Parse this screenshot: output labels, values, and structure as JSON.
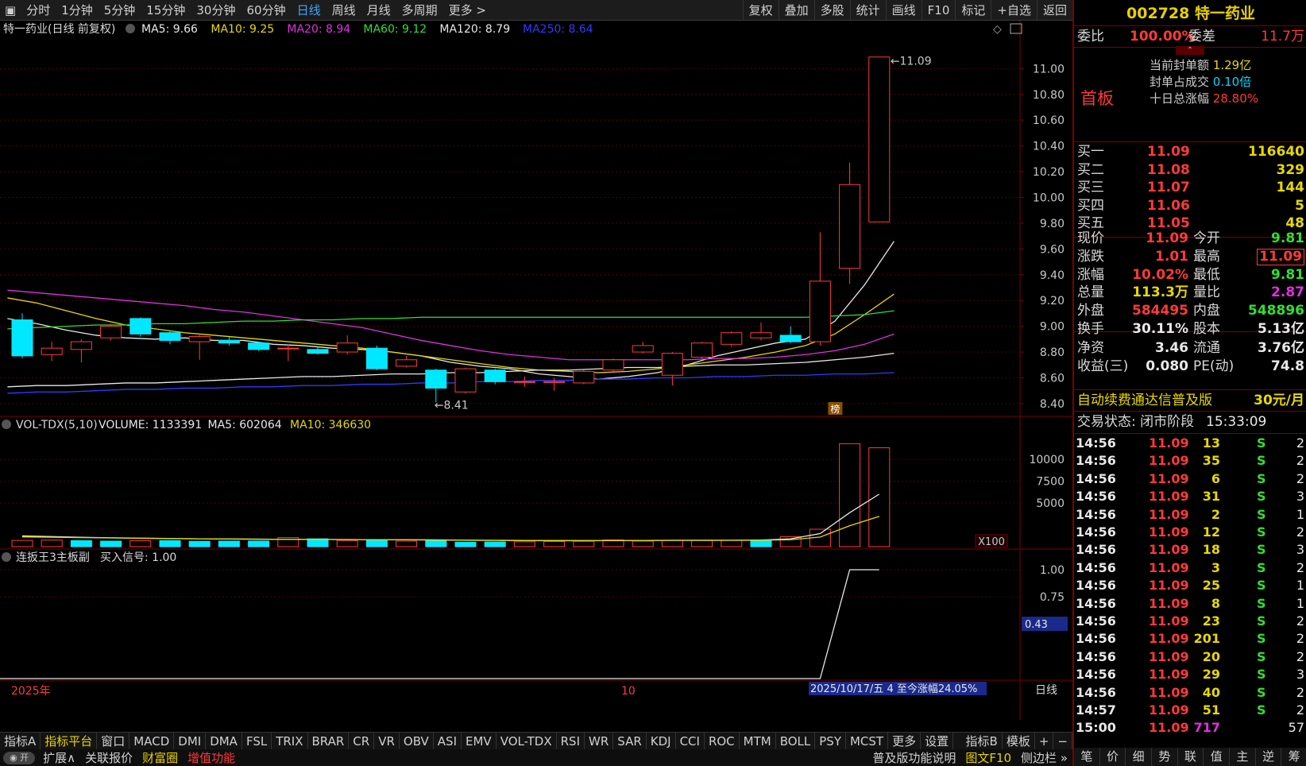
{
  "topbar": {
    "menu_icon": "menu-icon",
    "periods": [
      "分时",
      "1分钟",
      "5分钟",
      "15分钟",
      "30分钟",
      "60分钟",
      "日线",
      "周线",
      "月线",
      "多周期",
      "更多 >"
    ],
    "selected_period": "日线",
    "tools": [
      "复权",
      "叠加",
      "多股",
      "统计",
      "画线",
      "F10",
      "标记",
      "+自选",
      "返回"
    ]
  },
  "main_chart": {
    "title": "特一药业(日线 前复权)",
    "ma_legend": [
      {
        "label": "MA5: 9.66",
        "color": "#e8e8e8"
      },
      {
        "label": "MA10: 9.25",
        "color": "#e8d800"
      },
      {
        "label": "MA20: 8.94",
        "color": "#e030e0"
      },
      {
        "label": "MA60: 9.12",
        "color": "#33dd33"
      },
      {
        "label": "MA120: 8.79",
        "color": "#e8e8e8"
      },
      {
        "label": "MA250: 8.64",
        "color": "#2c3cff"
      }
    ],
    "high_label": "11.09",
    "low_label": "8.41",
    "bang_label": "榜"
  },
  "volume_chart": {
    "title": "VOL-TDX(5,10)",
    "legend": [
      {
        "label": "VOLUME: 1133391",
        "color": "#e8e8e8"
      },
      {
        "label": "MA5: 602064",
        "color": "#e8e8e8"
      },
      {
        "label": "MA10: 346630",
        "color": "#e8d800"
      }
    ],
    "unit": "X100"
  },
  "signal_chart": {
    "title": "连扳王3主板副",
    "legend": "买入信号: 1.00",
    "current_value": "0.43"
  },
  "date_axis": {
    "year_label": "2025年",
    "month_label": "10",
    "info": "2025/10/17/五 4 至今涨幅24.05%",
    "period_label": "日线"
  },
  "chart_data": [
    {
      "type": "candlestick",
      "title": "",
      "ylim": [
        8.35,
        11.15
      ],
      "yticks": [
        "11.00",
        "10.80",
        "10.60",
        "10.40",
        "10.20",
        "10.00",
        "9.80",
        "9.60",
        "9.40",
        "9.20",
        "9.00",
        "8.80",
        "8.60",
        "8.40"
      ],
      "candles": [
        {
          "o": 9.05,
          "c": 8.77,
          "h": 9.1,
          "l": 8.75
        },
        {
          "o": 8.78,
          "c": 8.83,
          "h": 8.88,
          "l": 8.73
        },
        {
          "o": 8.82,
          "c": 8.88,
          "h": 8.9,
          "l": 8.72
        },
        {
          "o": 8.91,
          "c": 9.0,
          "h": 9.02,
          "l": 8.89
        },
        {
          "o": 9.06,
          "c": 8.94,
          "h": 9.07,
          "l": 8.92
        },
        {
          "o": 8.95,
          "c": 8.89,
          "h": 8.96,
          "l": 8.86
        },
        {
          "o": 8.88,
          "c": 8.92,
          "h": 8.94,
          "l": 8.74
        },
        {
          "o": 8.89,
          "c": 8.87,
          "h": 8.92,
          "l": 8.85
        },
        {
          "o": 8.87,
          "c": 8.82,
          "h": 8.88,
          "l": 8.81
        },
        {
          "o": 8.83,
          "c": 8.83,
          "h": 8.86,
          "l": 8.73
        },
        {
          "o": 8.82,
          "c": 8.79,
          "h": 8.84,
          "l": 8.78
        },
        {
          "o": 8.8,
          "c": 8.87,
          "h": 8.93,
          "l": 8.78
        },
        {
          "o": 8.83,
          "c": 8.67,
          "h": 8.85,
          "l": 8.66
        },
        {
          "o": 8.69,
          "c": 8.74,
          "h": 8.77,
          "l": 8.68
        },
        {
          "o": 8.66,
          "c": 8.52,
          "h": 8.67,
          "l": 8.41
        },
        {
          "o": 8.49,
          "c": 8.67,
          "h": 8.68,
          "l": 8.48
        },
        {
          "o": 8.66,
          "c": 8.57,
          "h": 8.67,
          "l": 8.55
        },
        {
          "o": 8.57,
          "c": 8.57,
          "h": 8.61,
          "l": 8.53
        },
        {
          "o": 8.57,
          "c": 8.57,
          "h": 8.6,
          "l": 8.5
        },
        {
          "o": 8.56,
          "c": 8.65,
          "h": 8.66,
          "l": 8.55
        },
        {
          "o": 8.66,
          "c": 8.74,
          "h": 8.75,
          "l": 8.65
        },
        {
          "o": 8.8,
          "c": 8.85,
          "h": 8.88,
          "l": 8.79
        },
        {
          "o": 8.62,
          "c": 8.79,
          "h": 8.8,
          "l": 8.54
        },
        {
          "o": 8.76,
          "c": 8.87,
          "h": 8.88,
          "l": 8.75
        },
        {
          "o": 8.86,
          "c": 8.95,
          "h": 8.96,
          "l": 8.84
        },
        {
          "o": 8.91,
          "c": 8.95,
          "h": 9.03,
          "l": 8.89
        },
        {
          "o": 8.93,
          "c": 8.88,
          "h": 9.0,
          "l": 8.87
        },
        {
          "o": 8.88,
          "c": 9.35,
          "h": 9.73,
          "l": 8.85
        },
        {
          "o": 9.45,
          "c": 10.1,
          "h": 10.27,
          "l": 9.33
        },
        {
          "o": 9.81,
          "c": 11.09,
          "h": 11.09,
          "l": 9.81
        }
      ],
      "ma_series": [
        {
          "name": "MA5",
          "color": "#e8e8e8",
          "values": [
            9.06,
            9.02,
            8.97,
            8.93,
            8.91,
            8.9,
            8.91,
            8.89,
            8.89,
            8.86,
            8.85,
            8.83,
            8.82,
            8.8,
            8.77,
            8.72,
            8.69,
            8.67,
            8.63,
            8.61,
            8.59,
            8.61,
            8.64,
            8.7,
            8.77,
            8.82,
            8.87,
            8.9,
            9.04,
            9.32,
            9.66
          ]
        },
        {
          "name": "MA10",
          "color": "#e8d800",
          "values": [
            9.22,
            9.18,
            9.12,
            9.06,
            9.01,
            8.98,
            8.95,
            8.93,
            8.91,
            8.89,
            8.87,
            8.85,
            8.83,
            8.8,
            8.77,
            8.74,
            8.71,
            8.68,
            8.66,
            8.65,
            8.64,
            8.65,
            8.67,
            8.7,
            8.73,
            8.76,
            8.8,
            8.85,
            8.94,
            9.09,
            9.25
          ]
        },
        {
          "name": "MA20",
          "color": "#e030e0",
          "values": [
            9.28,
            9.26,
            9.24,
            9.22,
            9.2,
            9.18,
            9.16,
            9.13,
            9.11,
            9.08,
            9.05,
            9.02,
            8.99,
            8.94,
            8.89,
            8.85,
            8.81,
            8.78,
            8.76,
            8.74,
            8.74,
            8.74,
            8.74,
            8.74,
            8.75,
            8.75,
            8.76,
            8.78,
            8.81,
            8.86,
            8.94
          ]
        },
        {
          "name": "MA60",
          "color": "#33dd33",
          "values": [
            8.98,
            8.99,
            9.0,
            9.01,
            9.01,
            9.02,
            9.02,
            9.03,
            9.04,
            9.04,
            9.05,
            9.05,
            9.06,
            9.06,
            9.07,
            9.07,
            9.07,
            9.07,
            9.07,
            9.07,
            9.07,
            9.07,
            9.07,
            9.07,
            9.07,
            9.07,
            9.07,
            9.07,
            9.08,
            9.09,
            9.12
          ]
        },
        {
          "name": "MA120",
          "color": "#e8e8e8",
          "values": [
            8.53,
            8.54,
            8.54,
            8.55,
            8.56,
            8.56,
            8.57,
            8.58,
            8.59,
            8.6,
            8.61,
            8.61,
            8.62,
            8.63,
            8.63,
            8.64,
            8.64,
            8.65,
            8.66,
            8.66,
            8.67,
            8.68,
            8.68,
            8.69,
            8.7,
            8.7,
            8.71,
            8.72,
            8.74,
            8.76,
            8.79
          ]
        },
        {
          "name": "MA250",
          "color": "#2c3cff",
          "values": [
            8.48,
            8.49,
            8.49,
            8.5,
            8.51,
            8.51,
            8.52,
            8.52,
            8.53,
            8.53,
            8.54,
            8.54,
            8.55,
            8.55,
            8.56,
            8.56,
            8.57,
            8.57,
            8.58,
            8.58,
            8.59,
            8.59,
            8.6,
            8.6,
            8.61,
            8.61,
            8.62,
            8.62,
            8.63,
            8.63,
            8.64
          ]
        }
      ]
    },
    {
      "type": "bar",
      "title": "",
      "ylim": [
        0,
        12200
      ],
      "yticks": [
        "10000",
        "7500",
        "5000"
      ],
      "values": [
        700,
        760,
        720,
        760,
        700,
        640,
        680,
        700,
        620,
        640,
        640,
        1040,
        900,
        700,
        720,
        640,
        700,
        520,
        540,
        560,
        600,
        620,
        780,
        640,
        720,
        740,
        720,
        780,
        1140,
        2000,
        11800,
        11334
      ],
      "up": [
        false,
        false,
        true,
        true,
        false,
        false,
        true,
        false,
        false,
        false,
        false,
        true,
        false,
        true,
        false,
        true,
        false,
        false,
        false,
        true,
        true,
        true,
        true,
        true,
        true,
        true,
        true,
        false,
        true,
        true,
        true,
        true
      ],
      "ma5": [
        1500,
        1360,
        1240,
        1160,
        1080,
        1020,
        980,
        940,
        900,
        880,
        860,
        840,
        830,
        820,
        800,
        790,
        770,
        740,
        720,
        700,
        690,
        690,
        700,
        720,
        740,
        740,
        740,
        760,
        900,
        1500,
        3900,
        6020
      ],
      "ma10": [
        1200,
        1160,
        1120,
        1080,
        1040,
        1000,
        960,
        930,
        900,
        880,
        860,
        840,
        830,
        820,
        800,
        790,
        780,
        760,
        740,
        720,
        710,
        700,
        700,
        710,
        720,
        720,
        730,
        740,
        800,
        1100,
        2400,
        3466
      ]
    },
    {
      "type": "line",
      "title": "",
      "ylim": [
        0,
        1.08
      ],
      "yticks": [
        "1.00",
        "0.75"
      ],
      "values": [
        0,
        0,
        0,
        0,
        0,
        0,
        0,
        0,
        0,
        0,
        0,
        0,
        0,
        0,
        0,
        0,
        0,
        0,
        0,
        0,
        0,
        0,
        0,
        0,
        0,
        0,
        0,
        0,
        0,
        1,
        1
      ]
    }
  ],
  "quote": {
    "code": "002728",
    "name": "特一药业",
    "weibi_label": "委比",
    "weibi_value": "100.00%",
    "weicha_label": "委差",
    "weicha_value": "11.7万",
    "first_board": "首板",
    "seal_amount_label": "当前封单额",
    "seal_amount_value": "1.29亿",
    "seal_ratio_label": "封单占成交",
    "seal_ratio_value": "0.10倍",
    "ten_day_label": "十日总涨幅",
    "ten_day_value": "28.80%",
    "bids": [
      {
        "label": "买一",
        "price": "11.09",
        "vol": "116640"
      },
      {
        "label": "买二",
        "price": "11.08",
        "vol": "329"
      },
      {
        "label": "买三",
        "price": "11.07",
        "vol": "144"
      },
      {
        "label": "买四",
        "price": "11.06",
        "vol": "5"
      },
      {
        "label": "买五",
        "price": "11.05",
        "vol": "48"
      }
    ],
    "stats": [
      {
        "l1": "现价",
        "v1": "11.09",
        "c1": "red",
        "l2": "今开",
        "v2": "9.81",
        "c2": "grn"
      },
      {
        "l1": "涨跌",
        "v1": "1.01",
        "c1": "red",
        "l2": "最高",
        "v2": "11.09",
        "c2": "red"
      },
      {
        "l1": "涨幅",
        "v1": "10.02%",
        "c1": "red",
        "l2": "最低",
        "v2": "9.81",
        "c2": "grn"
      },
      {
        "l1": "总量",
        "v1": "113.3万",
        "c1": "yel",
        "l2": "量比",
        "v2": "2.87",
        "c2": "mag"
      },
      {
        "l1": "外盘",
        "v1": "584495",
        "c1": "red",
        "l2": "内盘",
        "v2": "548896",
        "c2": "grn"
      }
    ],
    "stats2": [
      {
        "l1": "换手",
        "v1": "30.11%",
        "l2": "股本",
        "v2": "5.13亿"
      },
      {
        "l1": "净资",
        "v1": "3.46",
        "l2": "流通",
        "v2": "3.76亿"
      },
      {
        "l1": "收益(三)",
        "v1": "0.080",
        "l2": "PE(动)",
        "v2": "74.8"
      }
    ],
    "promo": "自动续费通达信普及版",
    "promo_price": "30元/月",
    "trade_status": "交易状态: 闭市阶段",
    "trade_time": "15:33:09",
    "ticks": [
      {
        "t": "14:56",
        "p": "11.09",
        "v": "13",
        "s": "S",
        "n": "2"
      },
      {
        "t": "14:56",
        "p": "11.09",
        "v": "35",
        "s": "S",
        "n": "2"
      },
      {
        "t": "14:56",
        "p": "11.09",
        "v": "6",
        "s": "S",
        "n": "2"
      },
      {
        "t": "14:56",
        "p": "11.09",
        "v": "31",
        "s": "S",
        "n": "3"
      },
      {
        "t": "14:56",
        "p": "11.09",
        "v": "2",
        "s": "S",
        "n": "1"
      },
      {
        "t": "14:56",
        "p": "11.09",
        "v": "12",
        "s": "S",
        "n": "2"
      },
      {
        "t": "14:56",
        "p": "11.09",
        "v": "18",
        "s": "S",
        "n": "3"
      },
      {
        "t": "14:56",
        "p": "11.09",
        "v": "3",
        "s": "S",
        "n": "2"
      },
      {
        "t": "14:56",
        "p": "11.09",
        "v": "25",
        "s": "S",
        "n": "1"
      },
      {
        "t": "14:56",
        "p": "11.09",
        "v": "8",
        "s": "S",
        "n": "1"
      },
      {
        "t": "14:56",
        "p": "11.09",
        "v": "23",
        "s": "S",
        "n": "2"
      },
      {
        "t": "14:56",
        "p": "11.09",
        "v": "201",
        "s": "S",
        "n": "2"
      },
      {
        "t": "14:56",
        "p": "11.09",
        "v": "20",
        "s": "S",
        "n": "2"
      },
      {
        "t": "14:56",
        "p": "11.09",
        "v": "29",
        "s": "S",
        "n": "3"
      },
      {
        "t": "14:56",
        "p": "11.09",
        "v": "40",
        "s": "S",
        "n": "2"
      },
      {
        "t": "14:57",
        "p": "11.09",
        "v": "51",
        "s": "S",
        "n": "2"
      },
      {
        "t": "15:00",
        "p": "11.09",
        "v": "717",
        "s": "",
        "n": "57"
      }
    ],
    "side_tabs": [
      "笔",
      "价",
      "细",
      "势",
      "联",
      "值",
      "主",
      "逆",
      "筹"
    ]
  },
  "bottombar": {
    "items": [
      "指标A",
      "指标平台",
      "窗口",
      "MACD",
      "DMI",
      "DMA",
      "FSL",
      "TRIX",
      "BRAR",
      "CR",
      "VR",
      "OBV",
      "ASI",
      "EMV",
      "VOL-TDX",
      "RSI",
      "WR",
      "SAR",
      "KDJ",
      "CCI",
      "ROC",
      "MTM",
      "BOLL",
      "PSY",
      "MCST",
      "更多",
      "设置"
    ],
    "active": "指标平台",
    "right": [
      "指标B",
      "模板",
      "+",
      "−"
    ]
  },
  "bottom2": {
    "toggle_label": "◉ 开",
    "items": [
      {
        "label": "扩展∧",
        "color": "#d0d0d0"
      },
      {
        "label": "关联报价",
        "color": "#d0d0d0"
      },
      {
        "label": "财富圈",
        "color": "#e8d000"
      },
      {
        "label": "增值功能",
        "color": "#ff3a3a"
      }
    ],
    "right_items": [
      {
        "label": "普及版功能说明",
        "color": "#d0d0d0"
      },
      {
        "label": "图文F10",
        "color": "#e8d000"
      },
      {
        "label": "侧边栏 »",
        "color": "#d0d0d0"
      }
    ]
  },
  "colors": {
    "up": "#ff3a3a",
    "down": "#00e8ff",
    "bg": "#000000",
    "frame": "#7a0000"
  }
}
